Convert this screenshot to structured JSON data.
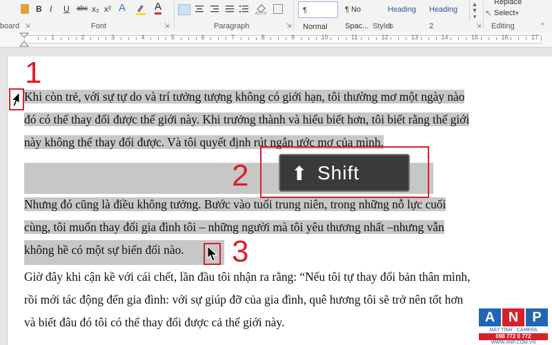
{
  "ribbon": {
    "buttons": [
      "B",
      "I",
      "U",
      "abc",
      "x₂",
      "x²",
      "A",
      "A"
    ],
    "groups": {
      "clipboard": "board",
      "font": "Font",
      "paragraph": "Paragraph",
      "styles": "Styles",
      "editing": "Editing"
    },
    "styles": [
      "¶ Normal",
      "¶ No Spac...",
      "Heading 1",
      "Heading 2"
    ],
    "editing": {
      "replace": "Replace",
      "select": "Select"
    }
  },
  "ruler": {
    "numbers": [
      "1",
      "2",
      "3",
      "4",
      "5",
      "6",
      "7",
      "8",
      "9",
      "10",
      "11",
      "12",
      "13",
      "14",
      "15",
      "16",
      "17"
    ]
  },
  "document": {
    "paragraph1": [
      "Khi còn trẻ, với sự tự do và trí tưởng tượng không có giới hạn, tôi thường mơ một ngày nào",
      "đó có thể thay đổi được thế giới này. Khi trưởng thành và hiểu biết hơn, tôi biết rằng thế giới",
      "này không thể thay đổi được. Và tôi quyết định rút ngắn ước mơ của mình."
    ],
    "paragraph2": [
      "Nhưng đó cũng là điều không tưởng. Bước vào tuổi trung niên, trong những nỗ lực cuối",
      "cùng, tôi muốn thay đổi gia đình tôi – những người mà tôi yêu thương nhất –nhưng vẫn",
      "không hề có một sự biến đổi nào."
    ],
    "paragraph3": [
      "Giờ đây khi cận kề với cái chết, lần đầu tôi nhận ra rằng: “Nếu tôi tự thay đổi bản thân mình,",
      "rồi mới tác động đến gia đình: với sự giúp đỡ của gia đình, quê hương tôi sẽ trở nên tốt hơn",
      "và biết đâu đó tôi có thể thay đổi được cả thế giới này."
    ]
  },
  "annotations": {
    "step1": "1",
    "step2": "2",
    "step3": "3",
    "key_label": "Shift",
    "key_arrow": "⬆"
  },
  "logo": {
    "letters": [
      "A",
      "N",
      "P"
    ],
    "line1": "MÁY TÍNH · CAMERA",
    "phone": "098 772 0 772",
    "url": "WWW.ANP.COM.VN"
  },
  "colors": {
    "annotation": "#d6202a",
    "selection": "#c7c7c7",
    "logo_blue": "#1f66b3",
    "logo_red": "#d6202a"
  }
}
